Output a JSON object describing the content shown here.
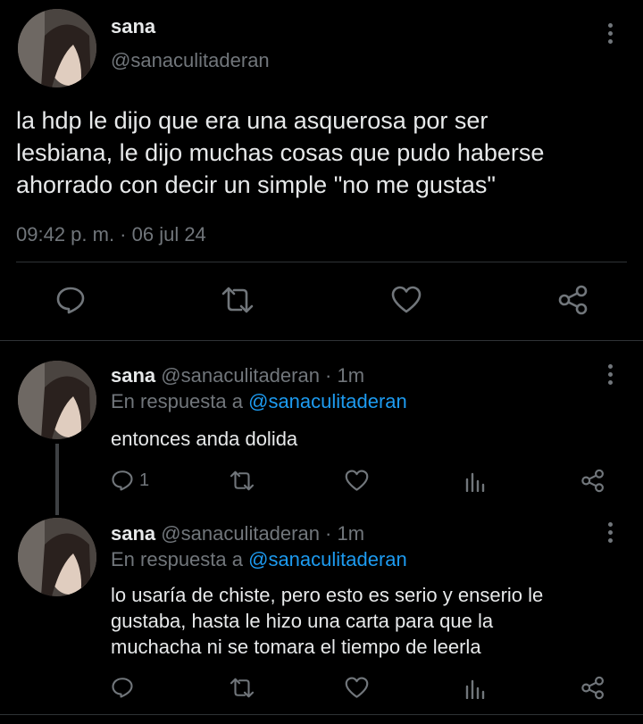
{
  "main_tweet": {
    "name": "sana",
    "handle": "@sanaculitaderan",
    "text_lines": [
      "la hdp le dijo que era una asquerosa por ser",
      "lesbiana, le dijo muchas cosas que pudo haberse",
      "ahorrado con decir un simple \"no me gustas\""
    ],
    "timestamp": "09:42 p. m. · 06 jul 24",
    "icons": [
      "reply-icon",
      "retweet-icon",
      "like-icon",
      "share-icon"
    ]
  },
  "replies": [
    {
      "name": "sana",
      "handle_time": "@sanaculitaderan · 1m",
      "in_reply_prefix": "En respuesta a",
      "in_reply_handle": "@sanaculitaderan",
      "text_lines": [
        "entonces anda dolida"
      ],
      "reply_count": "1"
    },
    {
      "name": "sana",
      "handle_time": "@sanaculitaderan · 1m",
      "in_reply_prefix": "En respuesta a",
      "in_reply_handle": "@sanaculitaderan",
      "text_lines": [
        "lo usaría de chiste, pero esto es serio y enserio le",
        "gustaba, hasta le hizo una carta para que la",
        "muchacha ni se tomara el tiempo de leerla"
      ],
      "reply_count": ""
    }
  ],
  "colors": {
    "background": "#000000",
    "text": "#e7e9ea",
    "muted": "#71767b",
    "accent": "#1d9bf0",
    "divider": "#2f3336"
  }
}
